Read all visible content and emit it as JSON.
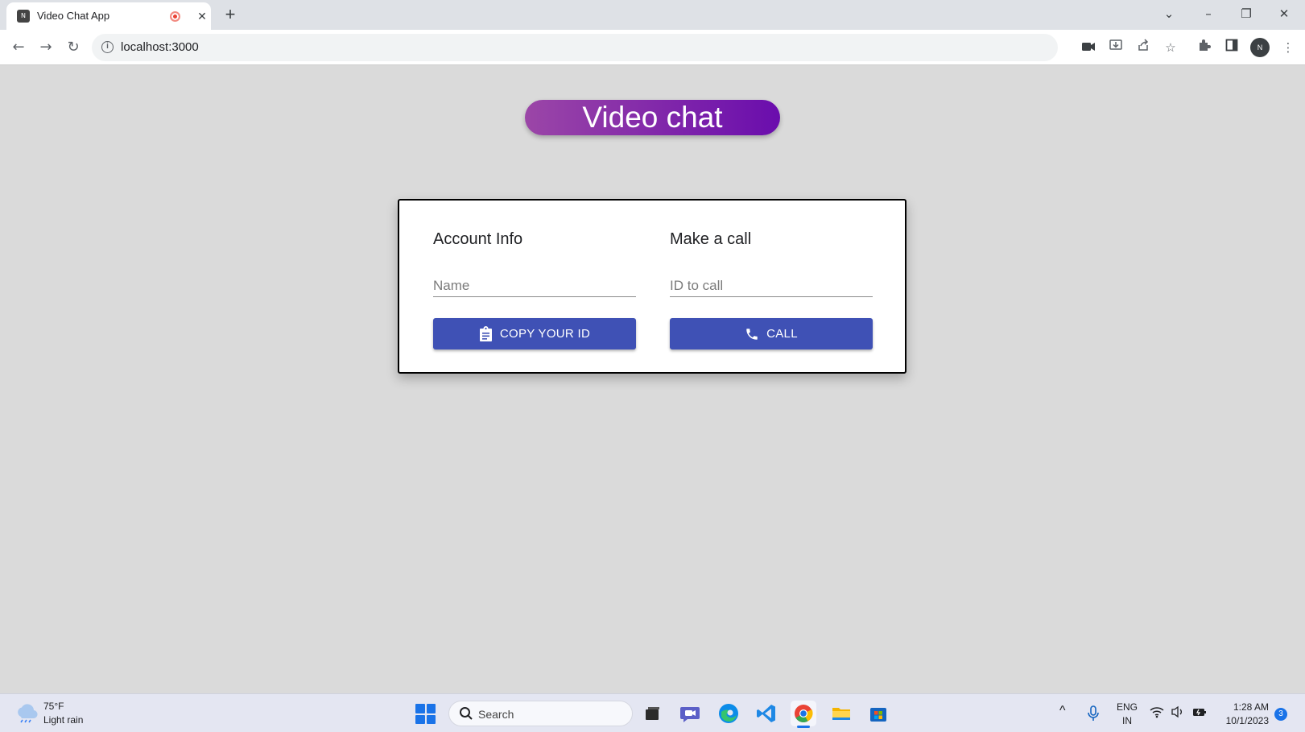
{
  "browser": {
    "tab_title": "Video Chat App",
    "tab_favicon_text": "N",
    "url": "localhost:3000",
    "profile_initials": "N"
  },
  "app": {
    "title": "Video chat"
  },
  "account_info": {
    "heading": "Account Info",
    "name_placeholder": "Name",
    "copy_button_label": "COPY YOUR ID"
  },
  "make_call": {
    "heading": "Make a call",
    "id_placeholder": "ID to call",
    "call_button_label": "CALL"
  },
  "colors": {
    "primary_button": "#3f51b5",
    "title_gradient_start": "#9b46a7",
    "title_gradient_end": "#6a0dad",
    "page_background": "#dadada"
  },
  "taskbar": {
    "weather_temp": "75°F",
    "weather_desc": "Light rain",
    "search_label": "Search",
    "lang_top": "ENG",
    "lang_bottom": "IN",
    "time": "1:28 AM",
    "date": "10/1/2023",
    "notification_count": "3"
  }
}
